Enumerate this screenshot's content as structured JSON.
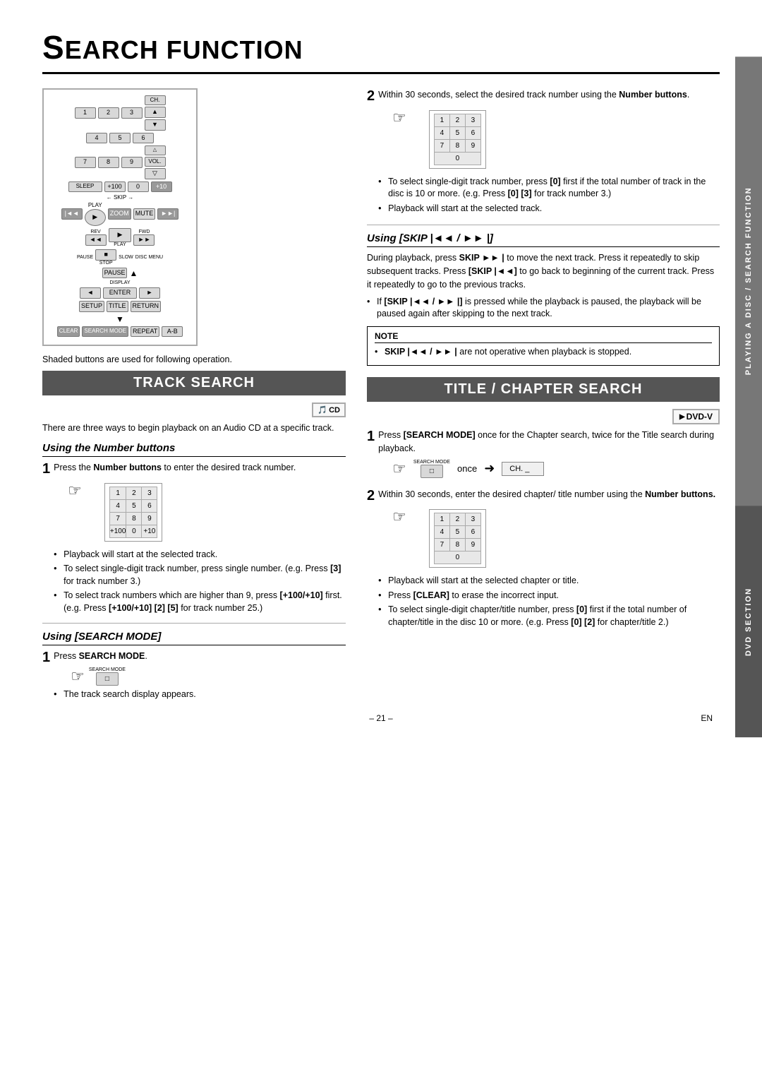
{
  "page": {
    "title": "SEARCH FUNCTION",
    "title_s": "S",
    "title_rest": "EARCH FUNCTION"
  },
  "remote": {
    "shaded_note": "Shaded buttons are used for following operation."
  },
  "track_search": {
    "header": "TRACK SEARCH",
    "intro": "There are three ways to begin playback on an Audio CD at a specific track.",
    "logo": "CD",
    "using_number": {
      "heading": "Using the Number buttons",
      "step1_text": "Press the Number buttons to enter the desired track number.",
      "keypad_rows": [
        [
          "1",
          "2",
          "3"
        ],
        [
          "4",
          "5",
          "6"
        ],
        [
          "7",
          "8",
          "9"
        ],
        [
          "+100",
          "0",
          "+10"
        ]
      ],
      "bullets": [
        "Playback will start at the selected track.",
        "To select single-digit track number, press single number. (e.g. Press [3] for track number 3.)",
        "To select track numbers which are higher than 9, press [+100/+10] first. (e.g. Press [+100/+10] [2] [5] for track number 25.)"
      ]
    },
    "using_search_mode": {
      "heading": "Using [SEARCH MODE]",
      "step1_text": "Press SEARCH MODE.",
      "bullet": "The track search display appears."
    }
  },
  "right_col": {
    "step2_number": "2",
    "step2_text": "Within 30 seconds, select the desired track number using the Number buttons.",
    "keypad_rows": [
      [
        "1",
        "2",
        "3"
      ],
      [
        "4",
        "5",
        "6"
      ],
      [
        "7",
        "8",
        "9"
      ],
      [
        "0",
        "",
        ""
      ]
    ],
    "bullets_number": [
      "To select single-digit track number, press [0] first if the total number of track in the disc is 10 or more. (e.g. Press [0] [3] for track number 3.)",
      "Playback will start at the selected track."
    ],
    "using_skip": {
      "heading": "Using [SKIP |◄◄ / ►►|]",
      "text": "During playback, press SKIP ►►| to move the next track. Press it repeatedly to skip subsequent tracks. Press [SKIP |◄◄] to go back to beginning of the current track. Press it repeatedly to go to the previous tracks.",
      "bullet": "If [SKIP |◄◄ / ►►|] is pressed while the playback is paused, the playback will be paused again after skipping to the next track.",
      "note_title": "NOTE",
      "note_bullet": "SKIP |◄◄ / ►►| are not operative when playback is stopped."
    }
  },
  "title_chapter": {
    "header": "TITLE / CHAPTER SEARCH",
    "logo": "DVD-V",
    "step1_text": "Press [SEARCH MODE] once for the Chapter search, twice for the Title search during playback.",
    "once_label": "once",
    "step2_text": "Within 30 seconds, enter the desired chapter/ title number using the Number buttons.",
    "keypad_rows": [
      [
        "1",
        "2",
        "3"
      ],
      [
        "4",
        "5",
        "6"
      ],
      [
        "7",
        "8",
        "9"
      ],
      [
        "0",
        "",
        ""
      ]
    ],
    "bullets": [
      "Playback will start at the selected chapter or title.",
      "Press [CLEAR] to erase the incorrect input.",
      "To select single-digit chapter/title number, press [0] first if the total number of chapter/title in the disc 10 or more. (e.g. Press [0] [2] for chapter/title 2.)"
    ]
  },
  "sidebar": {
    "playing": "PLAYING A DISC / SEARCH FUNCTION",
    "dvd": "DVD SECTION"
  },
  "footer": {
    "page_num": "– 21 –",
    "lang": "EN"
  }
}
